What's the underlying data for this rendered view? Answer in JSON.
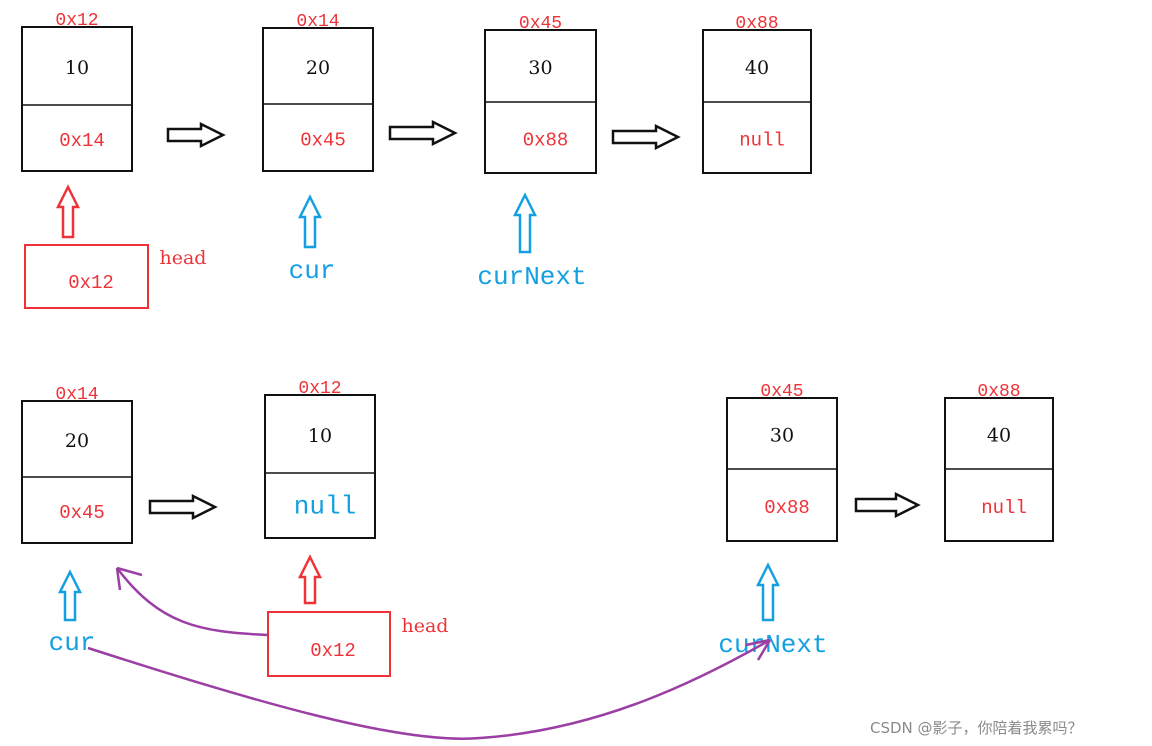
{
  "colors": {
    "red": "#ee3338",
    "blue": "#14a0e0",
    "black": "#111111",
    "purple": "#9b3fa5",
    "watermark": "#8a8a8a"
  },
  "top_row": {
    "nodes": [
      {
        "address": "0x12",
        "value": "10",
        "next": "0x14",
        "next_color": "red"
      },
      {
        "address": "0x14",
        "value": "20",
        "next": "0x45",
        "next_color": "red"
      },
      {
        "address": "0x45",
        "value": "30",
        "next": "0x88",
        "next_color": "red"
      },
      {
        "address": "0x88",
        "value": "40",
        "next": "null",
        "next_color": "red"
      }
    ],
    "head": {
      "label": "head",
      "value": "0x12"
    },
    "cur": {
      "label": "cur"
    },
    "cur_next": {
      "label": "curNext"
    }
  },
  "bottom_row": {
    "nodes": [
      {
        "address": "0x14",
        "value": "20",
        "next": "0x45",
        "next_color": "red"
      },
      {
        "address": "0x12",
        "value": "10",
        "next": "null",
        "next_color": "blue"
      },
      {
        "address": "0x45",
        "value": "30",
        "next": "0x88",
        "next_color": "red"
      },
      {
        "address": "0x88",
        "value": "40",
        "next": "null",
        "next_color": "red"
      }
    ],
    "head": {
      "label": "head",
      "value": "0x12"
    },
    "cur": {
      "label": "cur"
    },
    "cur_next": {
      "label": "curNext"
    }
  },
  "watermark": "CSDN @影子，你陪着我累吗？"
}
